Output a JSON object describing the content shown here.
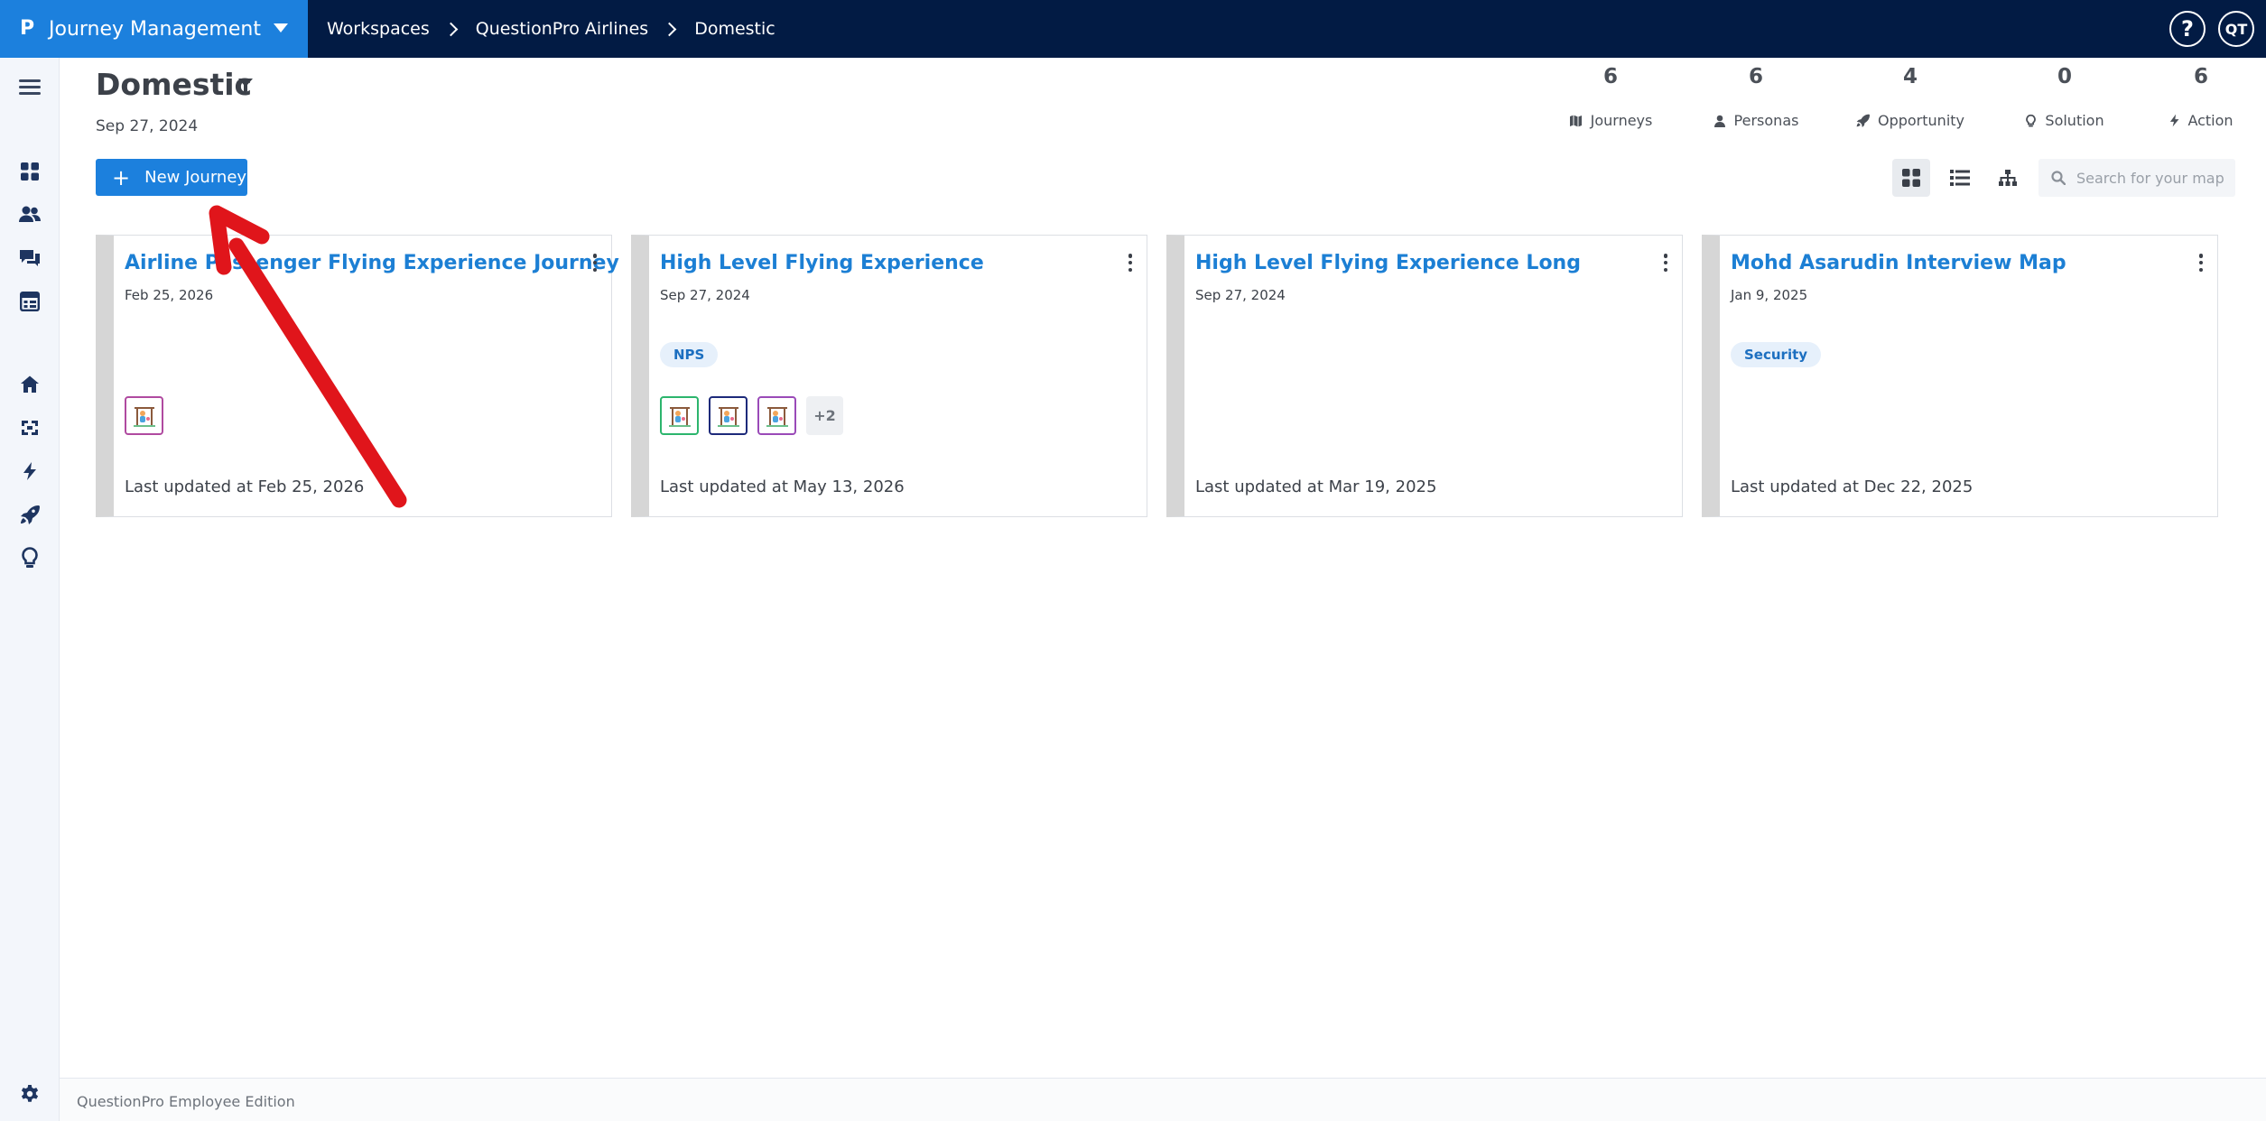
{
  "app": {
    "logo": "P",
    "name": "Journey Management"
  },
  "breadcrumb": [
    "Workspaces",
    "QuestionPro Airlines",
    "Domestic"
  ],
  "topbar": {
    "help": "?",
    "avatar": "QT"
  },
  "page": {
    "title": "Domestic",
    "date": "Sep 27, 2024"
  },
  "stats": [
    {
      "value": "6",
      "label": "Journeys",
      "icon": "map-icon"
    },
    {
      "value": "6",
      "label": "Personas",
      "icon": "person-icon"
    },
    {
      "value": "4",
      "label": "Opportunity",
      "icon": "rocket-icon"
    },
    {
      "value": "0",
      "label": "Solution",
      "icon": "lightbulb-icon"
    },
    {
      "value": "6",
      "label": "Action",
      "icon": "bolt-icon"
    }
  ],
  "toolbar": {
    "new_journey_label": "New Journey",
    "search_placeholder": "Search for your map",
    "active_view": "grid"
  },
  "cards": [
    {
      "title": "Airline Passenger Flying Experience Journey",
      "date": "Feb 25, 2026",
      "tag": "",
      "more": "",
      "updated": "Last updated at Feb 25, 2026"
    },
    {
      "title": "High Level Flying Experience",
      "date": "Sep 27, 2024",
      "tag": "NPS",
      "more": "+2",
      "updated": "Last updated at May 13, 2026"
    },
    {
      "title": "High Level Flying Experience Long",
      "date": "Sep 27, 2024",
      "tag": "",
      "more": "",
      "updated": "Last updated at Mar 19, 2025"
    },
    {
      "title": "Mohd Asarudin Interview Map",
      "date": "Jan 9, 2025",
      "tag": "Security",
      "more": "",
      "updated": "Last updated at Dec 22, 2025"
    }
  ],
  "footer": {
    "text": "QuestionPro Employee Edition"
  },
  "colors": {
    "primary": "#1c80dd",
    "topbar": "#021b44",
    "annotation": "#e0151b"
  }
}
